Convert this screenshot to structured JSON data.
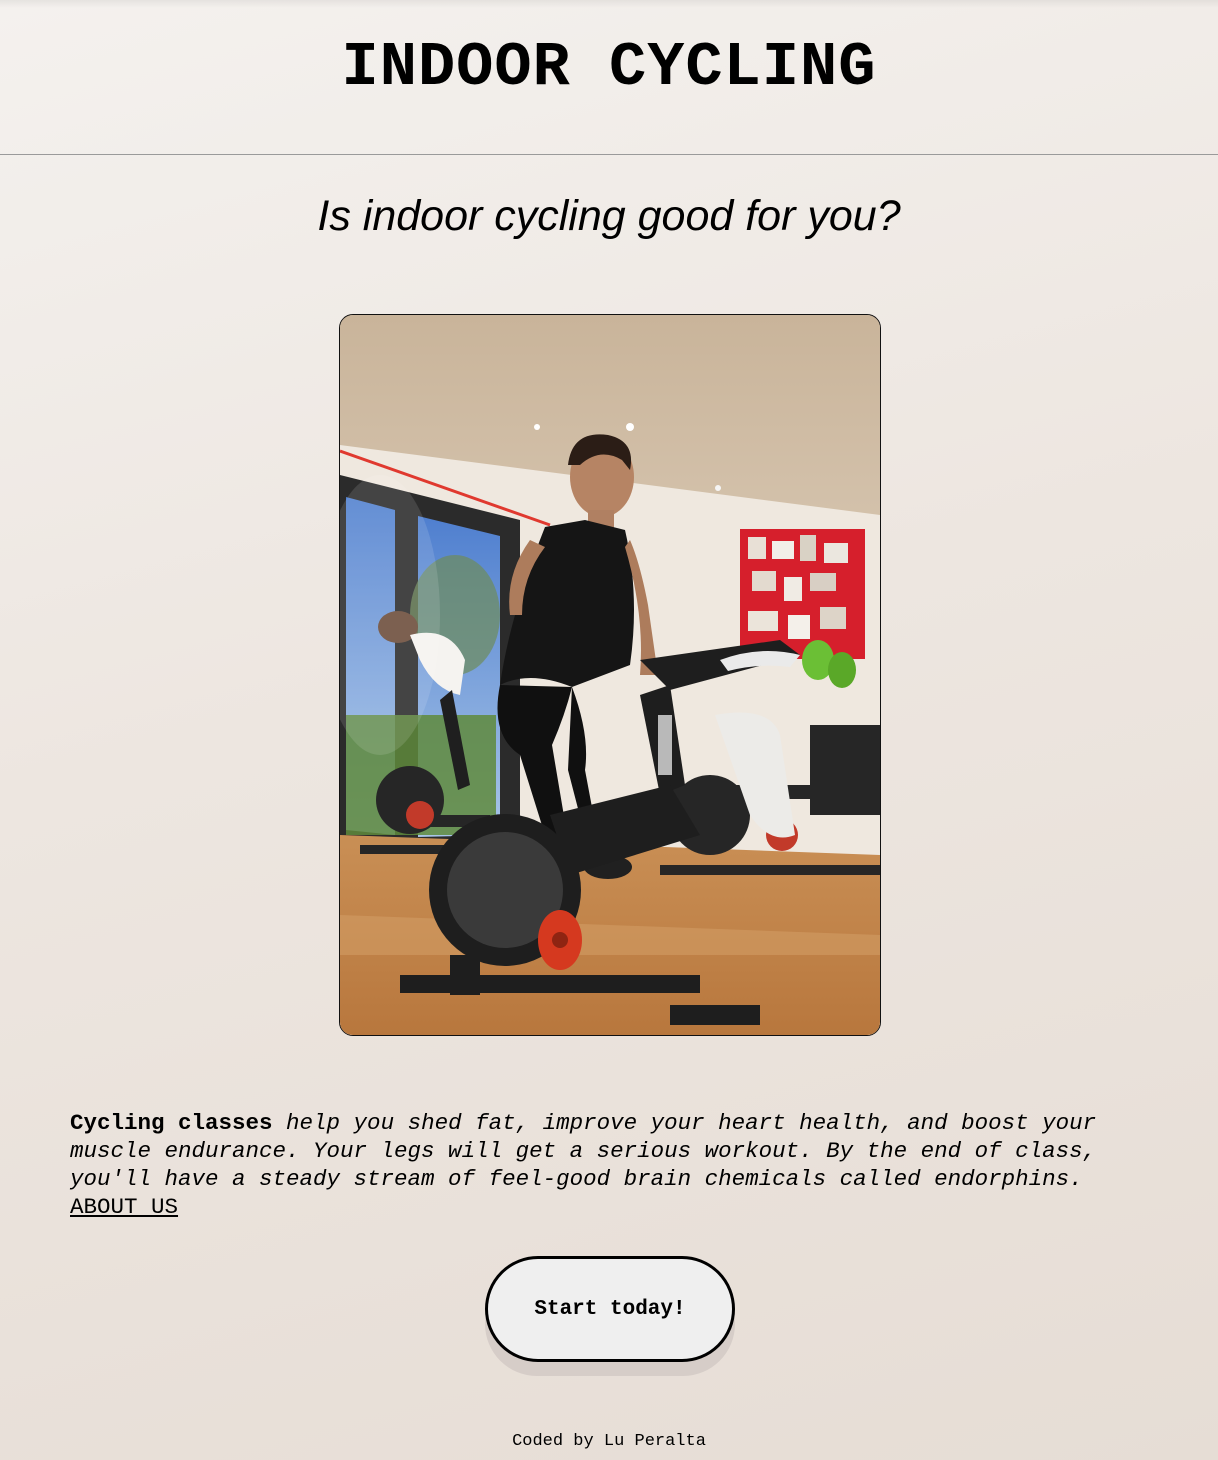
{
  "header": {
    "title": "INDOOR CYCLING"
  },
  "hero": {
    "subtitle": "Is indoor cycling good for you?",
    "photo_description": "Woman riding a stationary bike in a sunny gym studio with other bikes and riders"
  },
  "description": {
    "lead": "Cycling classes",
    "body": " help you shed fat, improve your heart health, and boost your muscle endurance. Your legs will get a serious workout. By the end of class, you'll have a steady stream of feel-good brain chemicals called endorphins.",
    "link_label": "ABOUT US"
  },
  "cta": {
    "label": "Start today!"
  },
  "footer": {
    "credit": "Coded by Lu Peralta"
  },
  "colors": {
    "background": "#f1ebe6",
    "text": "#000000",
    "button_fill": "#efefef",
    "button_shadow": "#d6cdc8"
  }
}
